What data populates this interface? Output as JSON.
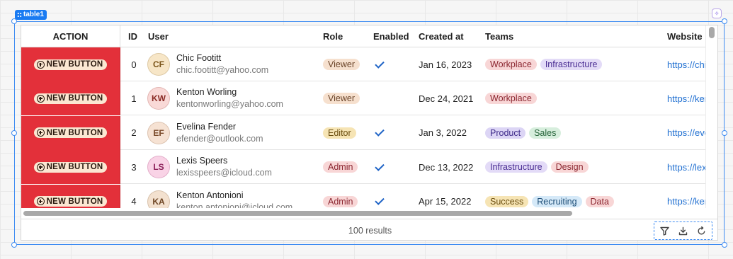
{
  "widget": {
    "name": "table1"
  },
  "table": {
    "columns": {
      "action": "ACTION",
      "id": "ID",
      "user": "User",
      "role": "Role",
      "enabled": "Enabled",
      "created": "Created at",
      "teams": "Teams",
      "website": "Website"
    },
    "rows": [
      {
        "action_label": "NEW BUTTON",
        "id": "0",
        "initials": "CF",
        "name": "Chic Footitt",
        "email": "chic.footitt@yahoo.com",
        "role": "Viewer",
        "enabled": true,
        "created": "Jan 16, 2023",
        "teams": [
          "Workplace",
          "Infrastructure"
        ],
        "website": "https://chic"
      },
      {
        "action_label": "NEW BUTTON",
        "id": "1",
        "initials": "KW",
        "name": "Kenton Worling",
        "email": "kentonworling@yahoo.com",
        "role": "Viewer",
        "enabled": false,
        "created": "Dec 24, 2021",
        "teams": [
          "Workplace"
        ],
        "website": "https://kent"
      },
      {
        "action_label": "NEW BUTTON",
        "id": "2",
        "initials": "EF",
        "name": "Evelina Fender",
        "email": "efender@outlook.com",
        "role": "Editor",
        "enabled": true,
        "created": "Jan 3, 2022",
        "teams": [
          "Product",
          "Sales"
        ],
        "website": "https://eve"
      },
      {
        "action_label": "NEW BUTTON",
        "id": "3",
        "initials": "LS",
        "name": "Lexis Speers",
        "email": "lexisspeers@icloud.com",
        "role": "Admin",
        "enabled": true,
        "created": "Dec 13, 2022",
        "teams": [
          "Infrastructure",
          "Design"
        ],
        "website": "https://lex"
      },
      {
        "action_label": "NEW BUTTON",
        "id": "4",
        "initials": "KA",
        "name": "Kenton Antonioni",
        "email": "kenton.antonioni@icloud.com",
        "role": "Admin",
        "enabled": true,
        "created": "Apr 15, 2022",
        "teams": [
          "Success",
          "Recruiting",
          "Data"
        ],
        "website": "https://ken"
      }
    ]
  },
  "footer": {
    "results": "100 results",
    "icons": [
      "filter-icon",
      "download-icon",
      "refresh-icon"
    ]
  },
  "colors": {
    "selection": "#3d8bf2",
    "action_bg": "#e3303a",
    "link": "#1f6fd1",
    "check": "#1e63c6",
    "avatar": {
      "CF": [
        "#f7e6c7",
        "#7a5418"
      ],
      "KW": [
        "#f9d9d7",
        "#8a2b25"
      ],
      "EF": [
        "#f6e2d3",
        "#7a4a2a"
      ],
      "LS": [
        "#f9d3e6",
        "#8c1f5a"
      ],
      "KA": [
        "#f3e1cf",
        "#6e4523"
      ]
    },
    "roles": {
      "Viewer": [
        "#f6e0ce",
        "#6b4429"
      ],
      "Editor": [
        "#f6e4b4",
        "#6a4d0e"
      ],
      "Admin": [
        "#f8d6d6",
        "#8b2630"
      ]
    },
    "teams": {
      "Workplace": [
        "#f8d6d6",
        "#8b2630"
      ],
      "Infrastructure": [
        "#e3dbf7",
        "#4b2e93"
      ],
      "Product": [
        "#dcd5f5",
        "#3f2b8a"
      ],
      "Sales": [
        "#d7eedd",
        "#256339"
      ],
      "Design": [
        "#f8d6d6",
        "#8b2630"
      ],
      "Success": [
        "#f6e4b4",
        "#6a4d0e"
      ],
      "Recruiting": [
        "#d5e9f8",
        "#1f4f78"
      ],
      "Data": [
        "#f8d6d6",
        "#8b2630"
      ]
    }
  }
}
